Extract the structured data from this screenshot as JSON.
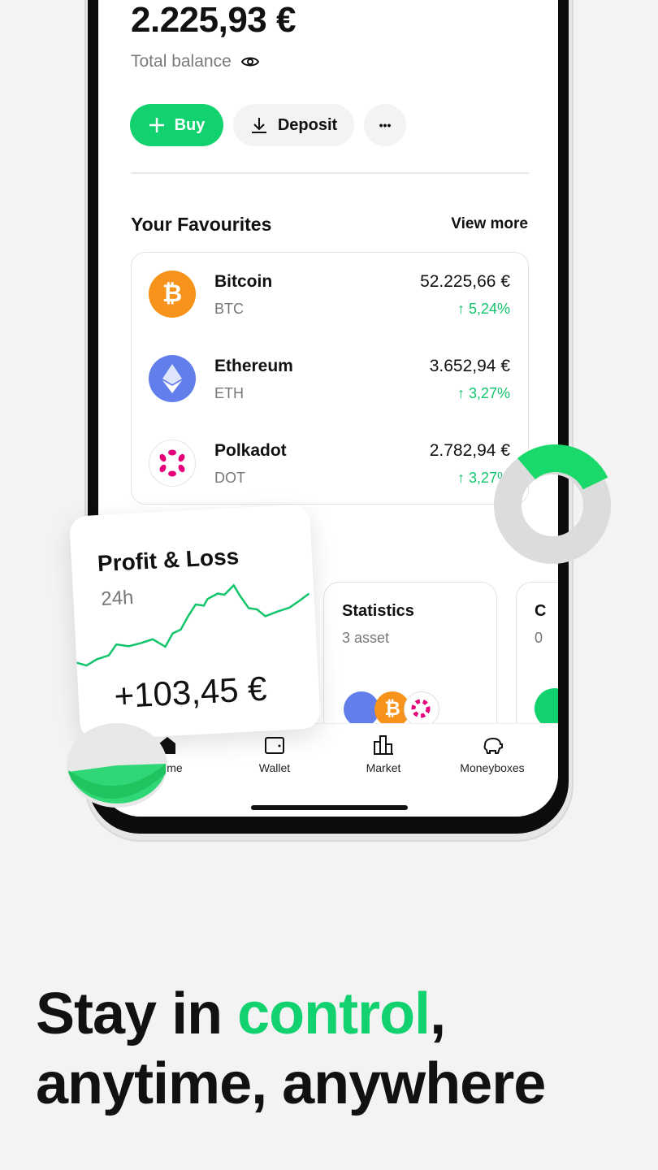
{
  "balance": {
    "amount": "2.225,93 €",
    "label": "Total balance",
    "eye_icon": "eye-icon"
  },
  "actions": {
    "buy": "Buy",
    "deposit": "Deposit",
    "more": "•••"
  },
  "favourites": {
    "title": "Your Favourites",
    "view_more": "View more",
    "items": [
      {
        "name": "Bitcoin",
        "symbol": "BTC",
        "price": "52.225,66 €",
        "change": "↑ 5,24%",
        "color": "#f7931a"
      },
      {
        "name": "Ethereum",
        "symbol": "ETH",
        "price": "3.652,94 €",
        "change": "↑ 3,27%",
        "color": "#627eea"
      },
      {
        "name": "Polkadot",
        "symbol": "DOT",
        "price": "2.782,94 €",
        "change": "↑ 3,27%",
        "color": "#e6007a"
      }
    ]
  },
  "profit_loss": {
    "title": "Profit & Loss",
    "period": "24h",
    "value": "+103,45 €"
  },
  "statistics": {
    "title": "Statistics",
    "subtitle": "3 asset"
  },
  "partial_card": {
    "title": "C",
    "subtitle": "0"
  },
  "nav": {
    "items": [
      {
        "label": "Home"
      },
      {
        "label": "Wallet"
      },
      {
        "label": "Market"
      },
      {
        "label": "Moneyboxes"
      }
    ]
  },
  "headline": {
    "line1_pre": "Stay in ",
    "line1_accent": "control",
    "line1_post": ",",
    "line2": "anytime, anywhere"
  },
  "colors": {
    "accent": "#12d16f",
    "background": "#f3f3f3"
  }
}
